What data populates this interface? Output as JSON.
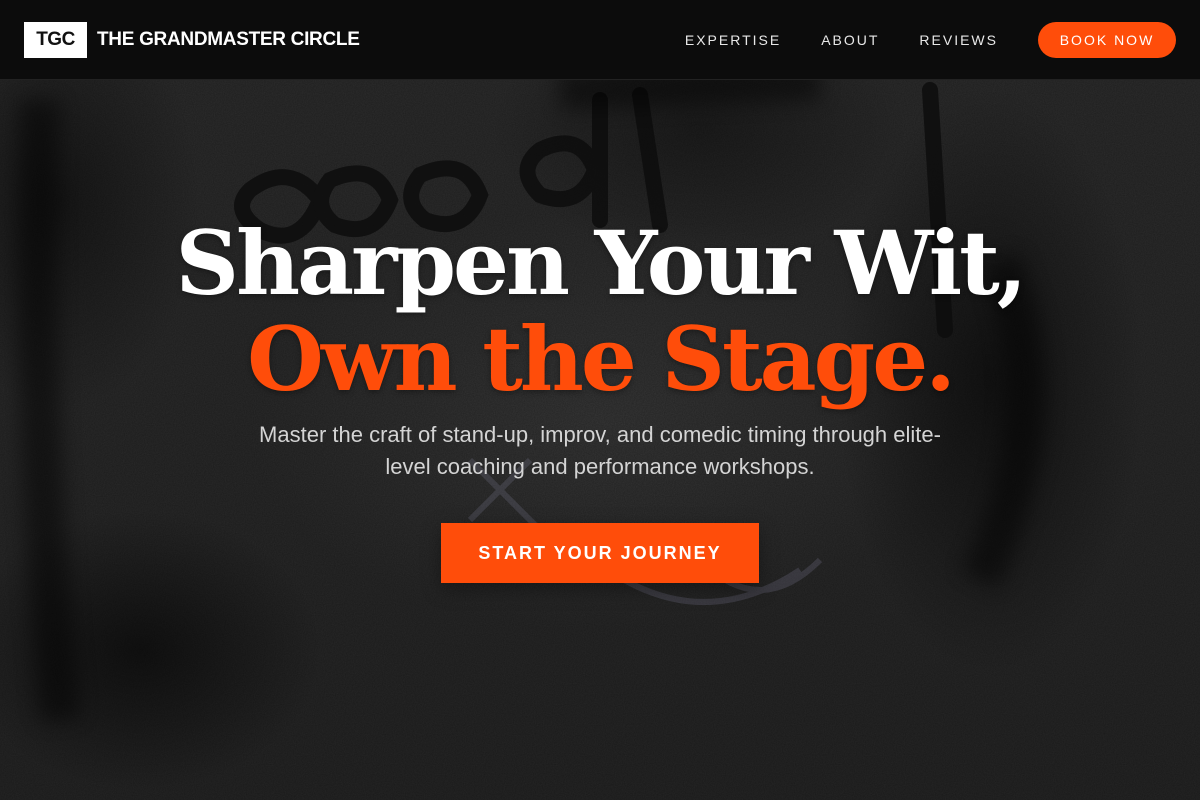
{
  "header": {
    "logo_text": "TGC",
    "brand_name": "THE GRANDMASTER CIRCLE",
    "nav": [
      "EXPERTISE",
      "ABOUT",
      "REVIEWS"
    ],
    "cta_label": "BOOK NOW"
  },
  "hero": {
    "headline_line1": "Sharpen Your Wit,",
    "headline_line2": "Own the Stage.",
    "subheadline": "Master the craft of stand-up, improv, and comedic timing through elite-level coaching and performance workshops.",
    "cta_label": "START YOUR JOURNEY"
  },
  "colors": {
    "accent": "#ff4d0a",
    "header_bg": "#0c0c0c",
    "text_primary": "#ffffff",
    "text_secondary": "#d4d4d4"
  }
}
